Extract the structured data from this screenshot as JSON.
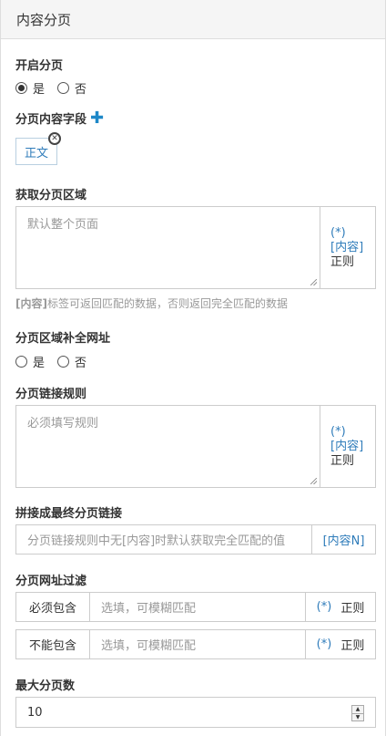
{
  "panel": {
    "title": "内容分页"
  },
  "paging": {
    "label": "开启分页",
    "options": [
      {
        "label": "是",
        "checked": true
      },
      {
        "label": "否",
        "checked": false
      }
    ]
  },
  "fields": {
    "label": "分页内容字段",
    "tag": "正文"
  },
  "area": {
    "label": "获取分页区域",
    "placeholder": "默认整个页面",
    "side_star": "(*)",
    "side_content": "[内容]",
    "side_regex": "正则",
    "help_bold": "[内容]",
    "help_rest": "标签可返回匹配的数据，否则返回完全匹配的数据"
  },
  "complete_url": {
    "label": "分页区域补全网址",
    "options": [
      {
        "label": "是",
        "checked": false
      },
      {
        "label": "否",
        "checked": false
      }
    ]
  },
  "rule": {
    "label": "分页链接规则",
    "placeholder": "必须填写规则",
    "side_star": "(*)",
    "side_content": "[内容]",
    "side_regex": "正则"
  },
  "final_link": {
    "label": "拼接成最终分页链接",
    "placeholder": "分页链接规则中无[内容]时默认获取完全匹配的值",
    "addon": "[内容N]"
  },
  "filter": {
    "label": "分页网址过滤",
    "must": {
      "addon": "必须包含",
      "placeholder": "选填，可模糊匹配",
      "star": "(*)",
      "regex": "正则"
    },
    "cannot": {
      "addon": "不能包含",
      "placeholder": "选填，可模糊匹配",
      "star": "(*)",
      "regex": "正则"
    }
  },
  "max_pages": {
    "label": "最大分页数",
    "value": "10"
  },
  "colors": {
    "accent": "#2f7cba",
    "plus": "#1e88c8"
  }
}
